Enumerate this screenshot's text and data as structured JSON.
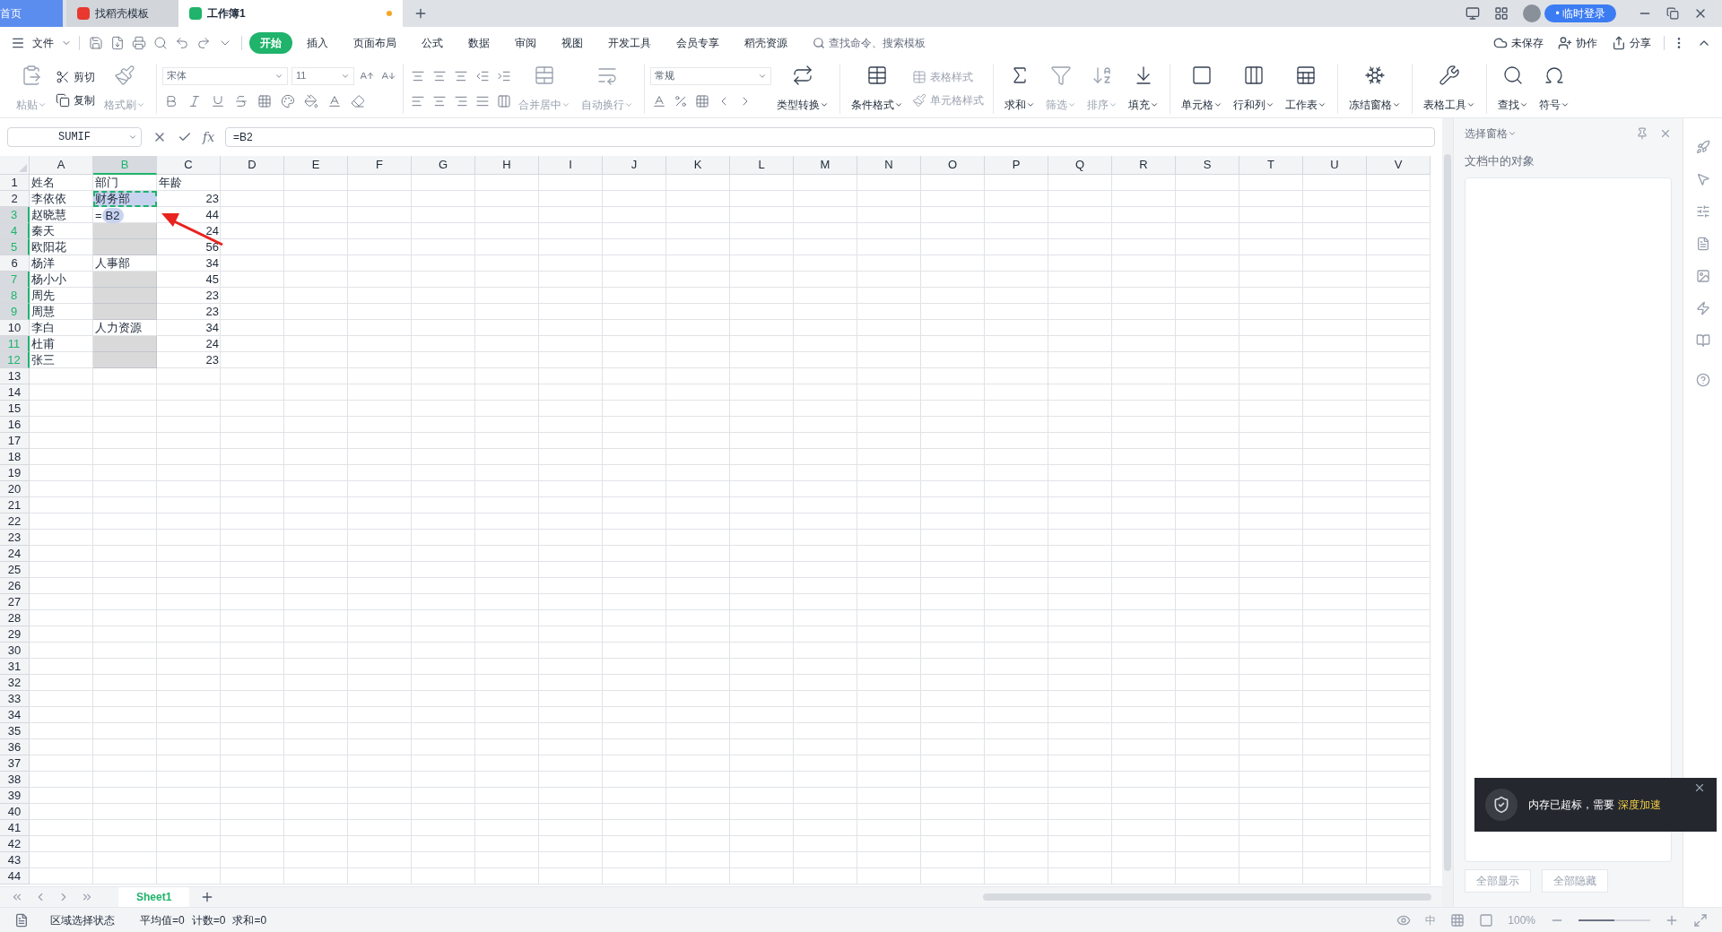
{
  "tabs": [
    {
      "label": "首页",
      "kind": "home",
      "selected": false
    },
    {
      "label": "找稻壳模板",
      "kind": "template",
      "selected": false
    },
    {
      "label": "工作簿1",
      "kind": "sheet",
      "selected": true,
      "unsaved": true
    }
  ],
  "account": {
    "login": "• 临时登录"
  },
  "menu": [
    {
      "label": "文件",
      "selected": false
    },
    {
      "label": "开始",
      "selected": true
    },
    {
      "label": "插入",
      "selected": false
    },
    {
      "label": "页面布局",
      "selected": false
    },
    {
      "label": "公式",
      "selected": false
    },
    {
      "label": "数据",
      "selected": false
    },
    {
      "label": "审阅",
      "selected": false
    },
    {
      "label": "视图",
      "selected": false
    },
    {
      "label": "开发工具",
      "selected": false
    },
    {
      "label": "会员专享",
      "selected": false
    },
    {
      "label": "稻壳资源",
      "selected": false
    }
  ],
  "search": {
    "placeholder": "查找命令、搜索模板"
  },
  "doc_actions": [
    {
      "label": "未保存"
    },
    {
      "label": "协作"
    },
    {
      "label": "分享"
    }
  ],
  "ribbon": {
    "paste": {
      "label": "粘贴",
      "disabled": true
    },
    "cut": {
      "label": "剪切",
      "disabled": false
    },
    "copy": {
      "label": "复制",
      "disabled": false
    },
    "format_painter": {
      "label": "格式刷",
      "disabled": true
    },
    "font": {
      "value": "宋体"
    },
    "size": {
      "value": "11"
    },
    "merge": {
      "label": "合并居中",
      "disabled": true
    },
    "wrap": {
      "label": "自动换行",
      "disabled": true
    },
    "number_format": {
      "value": "常规"
    },
    "convert": {
      "label": "类型转换",
      "disabled": false
    },
    "conditional": {
      "label": "条件格式",
      "disabled": false
    },
    "table_style": {
      "label": "表格样式",
      "disabled": true
    },
    "cell_style": {
      "label": "单元格样式",
      "disabled": true
    },
    "big": [
      {
        "label": "求和",
        "disabled": false
      },
      {
        "label": "筛选",
        "disabled": true
      },
      {
        "label": "排序",
        "disabled": true
      },
      {
        "label": "填充",
        "disabled": false
      },
      {
        "label": "单元格",
        "disabled": false
      },
      {
        "label": "行和列",
        "disabled": false
      },
      {
        "label": "工作表",
        "disabled": false
      },
      {
        "label": "冻结窗格",
        "disabled": false
      },
      {
        "label": "表格工具",
        "disabled": false
      },
      {
        "label": "查找",
        "disabled": false
      },
      {
        "label": "符号",
        "disabled": false
      }
    ]
  },
  "formula_bar": {
    "name_box": "SUMIF",
    "function_label": "fx",
    "formula": "=B2"
  },
  "columns": [
    {
      "label": "A",
      "selected": false
    },
    {
      "label": "B",
      "selected": true
    },
    {
      "label": "C",
      "selected": false
    },
    {
      "label": "D",
      "selected": false
    },
    {
      "label": "E",
      "selected": false
    },
    {
      "label": "F",
      "selected": false
    },
    {
      "label": "G",
      "selected": false
    },
    {
      "label": "H",
      "selected": false
    },
    {
      "label": "I",
      "selected": false
    },
    {
      "label": "J",
      "selected": false
    },
    {
      "label": "K",
      "selected": false
    },
    {
      "label": "L",
      "selected": false
    },
    {
      "label": "M",
      "selected": false
    },
    {
      "label": "N",
      "selected": false
    },
    {
      "label": "O",
      "selected": false
    },
    {
      "label": "P",
      "selected": false
    },
    {
      "label": "Q",
      "selected": false
    },
    {
      "label": "R",
      "selected": false
    },
    {
      "label": "S",
      "selected": false
    },
    {
      "label": "T",
      "selected": false
    },
    {
      "label": "U",
      "selected": false
    },
    {
      "label": "V",
      "selected": false
    }
  ],
  "rows": [
    {
      "number": "1",
      "selected": false,
      "name": "姓名",
      "dept": {
        "kind": "text",
        "text": "部门",
        "shaded": false,
        "copied": false
      },
      "age": {
        "kind": "text",
        "text": "年龄"
      }
    },
    {
      "number": "2",
      "selected": false,
      "name": "李依依",
      "dept": {
        "kind": "text",
        "text": "财务部",
        "shaded": false,
        "copied": true
      },
      "age": {
        "kind": "number",
        "text": "23"
      }
    },
    {
      "number": "3",
      "selected": true,
      "name": "赵晓慧",
      "dept": {
        "kind": "formula",
        "text": "=",
        "ref": "B2",
        "shaded": false,
        "copied": false
      },
      "age": {
        "kind": "number",
        "text": "44"
      }
    },
    {
      "number": "4",
      "selected": true,
      "name": "秦天",
      "dept": {
        "kind": "empty",
        "shaded": true,
        "copied": false
      },
      "age": {
        "kind": "number",
        "text": "24"
      }
    },
    {
      "number": "5",
      "selected": true,
      "name": "欧阳花",
      "dept": {
        "kind": "empty",
        "shaded": true,
        "copied": false
      },
      "age": {
        "kind": "number",
        "text": "56"
      }
    },
    {
      "number": "6",
      "selected": false,
      "name": "杨洋",
      "dept": {
        "kind": "text",
        "text": "人事部",
        "shaded": false,
        "copied": false
      },
      "age": {
        "kind": "number",
        "text": "34"
      }
    },
    {
      "number": "7",
      "selected": true,
      "name": "杨小小",
      "dept": {
        "kind": "empty",
        "shaded": true,
        "copied": false
      },
      "age": {
        "kind": "number",
        "text": "45"
      }
    },
    {
      "number": "8",
      "selected": true,
      "name": "周先",
      "dept": {
        "kind": "empty",
        "shaded": true,
        "copied": false
      },
      "age": {
        "kind": "number",
        "text": "23"
      }
    },
    {
      "number": "9",
      "selected": true,
      "name": "周慧",
      "dept": {
        "kind": "empty",
        "shaded": true,
        "copied": false
      },
      "age": {
        "kind": "number",
        "text": "23"
      }
    },
    {
      "number": "10",
      "selected": false,
      "name": "李白",
      "dept": {
        "kind": "text",
        "text": "人力资源",
        "shaded": false,
        "copied": false
      },
      "age": {
        "kind": "number",
        "text": "34"
      }
    },
    {
      "number": "11",
      "selected": true,
      "name": "杜甫",
      "dept": {
        "kind": "empty",
        "shaded": true,
        "copied": false
      },
      "age": {
        "kind": "number",
        "text": "24"
      }
    },
    {
      "number": "12",
      "selected": true,
      "name": "张三",
      "dept": {
        "kind": "empty",
        "shaded": true,
        "copied": false
      },
      "age": {
        "kind": "number",
        "text": "23"
      }
    },
    {
      "number": "13",
      "selected": false
    },
    {
      "number": "14",
      "selected": false
    },
    {
      "number": "15",
      "selected": false
    },
    {
      "number": "16",
      "selected": false
    },
    {
      "number": "17",
      "selected": false
    },
    {
      "number": "18",
      "selected": false
    },
    {
      "number": "19",
      "selected": false
    },
    {
      "number": "20",
      "selected": false
    },
    {
      "number": "21",
      "selected": false
    },
    {
      "number": "22",
      "selected": false
    },
    {
      "number": "23",
      "selected": false
    },
    {
      "number": "24",
      "selected": false
    },
    {
      "number": "25",
      "selected": false
    },
    {
      "number": "26",
      "selected": false
    },
    {
      "number": "27",
      "selected": false
    },
    {
      "number": "28",
      "selected": false
    },
    {
      "number": "29",
      "selected": false
    },
    {
      "number": "30",
      "selected": false
    },
    {
      "number": "31",
      "selected": false
    },
    {
      "number": "32",
      "selected": false
    },
    {
      "number": "33",
      "selected": false
    },
    {
      "number": "34",
      "selected": false
    },
    {
      "number": "35",
      "selected": false
    },
    {
      "number": "36",
      "selected": false
    },
    {
      "number": "37",
      "selected": false
    },
    {
      "number": "38",
      "selected": false
    },
    {
      "number": "39",
      "selected": false
    },
    {
      "number": "40",
      "selected": false
    },
    {
      "number": "41",
      "selected": false
    },
    {
      "number": "42",
      "selected": false
    },
    {
      "number": "43",
      "selected": false
    },
    {
      "number": "44",
      "selected": false
    }
  ],
  "sheets": [
    {
      "label": "Sheet1",
      "selected": true
    }
  ],
  "status_bar": {
    "mode": "区域选择状态",
    "stats": [
      "平均值=0",
      "计数=0",
      "求和=0"
    ],
    "input": "中",
    "zoom": "100%",
    "zoom_slider": {
      "level": 0.5
    }
  },
  "selection_pane": {
    "title": "选择窗格",
    "heading": "文档中的对象",
    "buttons": [
      "全部显示",
      "全部隐藏"
    ]
  },
  "notification": {
    "message": "内存已超标，需要",
    "action": "深度加速"
  }
}
